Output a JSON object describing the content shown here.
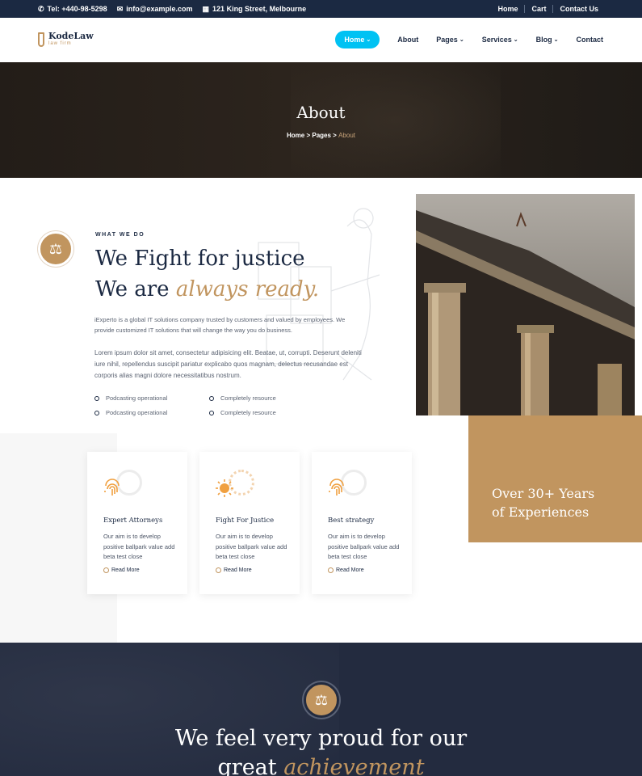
{
  "topbar": {
    "phone": "Tel: +440-98-5298",
    "email": "info@example.com",
    "address": "121 King Street, Melbourne",
    "links": [
      "Home",
      "Cart",
      "Contact Us"
    ]
  },
  "brand": {
    "name": "KodeLaw",
    "tagline": "law firm"
  },
  "menu": {
    "items": [
      {
        "label": "Home",
        "dropdown": true
      },
      {
        "label": "About",
        "dropdown": false
      },
      {
        "label": "Pages",
        "dropdown": true
      },
      {
        "label": "Services",
        "dropdown": true
      },
      {
        "label": "Blog",
        "dropdown": true
      },
      {
        "label": "Contact",
        "dropdown": false
      }
    ]
  },
  "hero": {
    "title": "About",
    "breadcrumb": {
      "home": "Home",
      "pages": "Pages",
      "current": "About"
    }
  },
  "about": {
    "eyebrow": "WHAT WE DO",
    "headline_line1": "We Fight for justice",
    "headline_line2_plain": "We are ",
    "headline_line2_accent": "always ready.",
    "para1": "iExperto is a global IT solutions company trusted by customers and valued by employees. We provide customized IT solutions that will change the way you do business.",
    "para2": "Lorem ipsum dolor sit amet, consectetur adipisicing elit. Beatae, ut, corrupti. Deserunt deleniti iure nihil, repellendus suscipit pariatur explicabo quos magnam, delectus recusandae est corporis alias magni dolore necessitatibus nostrum.",
    "features": [
      "Podcasting operational",
      "Completely resource",
      "Podcasting operational",
      "Completely resource"
    ]
  },
  "experience": {
    "line1": "Over 30+ Years",
    "line2": "of Experiences"
  },
  "cards": [
    {
      "title": "Expert Attorneys",
      "body": "Our aim is to develop positive ballpark value add beta test close",
      "more": "Read More",
      "icon": "fingerprint-icon"
    },
    {
      "title": "Fight For Justice",
      "body": "Our aim is to develop positive ballpark value add beta test close",
      "more": "Read More",
      "icon": "sun-icon"
    },
    {
      "title": "Best strategy",
      "body": "Our aim is to develop positive ballpark value add beta test close",
      "more": "Read More",
      "icon": "fingerprint-icon"
    }
  ],
  "achievement": {
    "line1": "We feel very proud for our",
    "line2_plain": "great ",
    "line2_accent": "achievement"
  },
  "colors": {
    "navy": "#1b2942",
    "gold": "#c1955f",
    "accent_blue": "#00c2f3"
  }
}
